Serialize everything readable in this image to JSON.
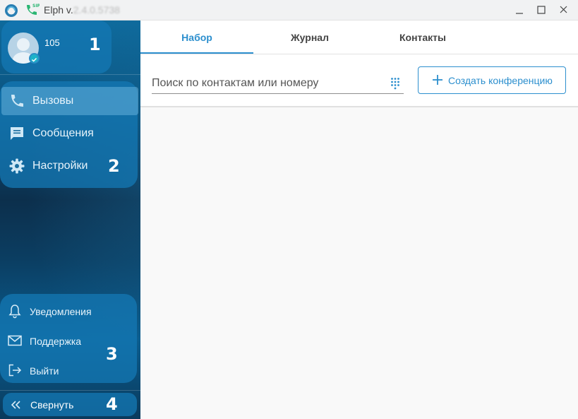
{
  "window": {
    "title": "Elph v.",
    "version": "2.4.0.5738",
    "controls": {
      "minimize": "minimize-icon",
      "maximize": "maximize-icon",
      "close": "close-icon"
    }
  },
  "user": {
    "number": "105",
    "badge": "1"
  },
  "nav": {
    "badge": "2",
    "items": [
      {
        "label": "Вызовы",
        "icon": "phone-icon",
        "active": true
      },
      {
        "label": "Сообщения",
        "icon": "message-icon",
        "active": false
      },
      {
        "label": "Настройки",
        "icon": "gear-icon",
        "active": false
      }
    ]
  },
  "utility": {
    "badge": "3",
    "items": [
      {
        "label": "Уведомления",
        "icon": "bell-icon"
      },
      {
        "label": "Поддержка",
        "icon": "mail-icon"
      },
      {
        "label": "Выйти",
        "icon": "logout-icon"
      }
    ]
  },
  "collapse": {
    "label": "Свернуть",
    "badge": "4",
    "icon": "double-chevron-left-icon"
  },
  "tabs": [
    {
      "label": "Набор",
      "active": true
    },
    {
      "label": "Журнал",
      "active": false
    },
    {
      "label": "Контакты",
      "active": false
    }
  ],
  "search": {
    "placeholder": "Поиск по контактам или номеру",
    "value": ""
  },
  "create_conference": {
    "label": "Создать конференцию"
  },
  "colors": {
    "accent": "#2c8fce",
    "sidebar": "#0a4f7a",
    "status": "#1bb3c9"
  }
}
